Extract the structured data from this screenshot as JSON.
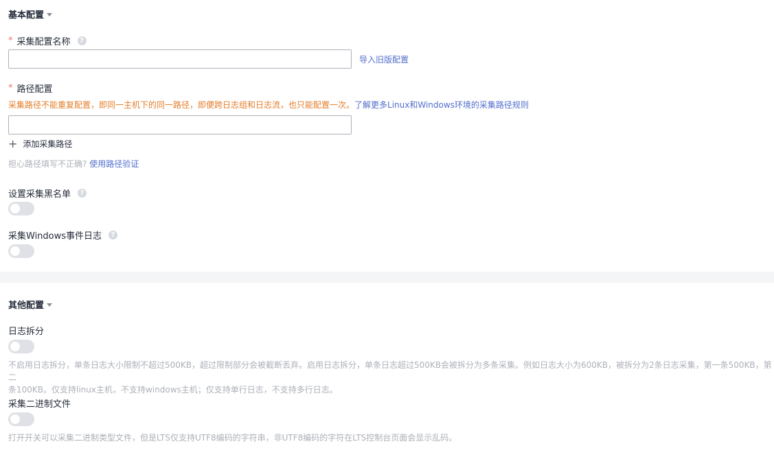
{
  "basic": {
    "title": "基本配置",
    "config_name": {
      "label": "采集配置名称",
      "value": ""
    },
    "import_link": "导入旧版配置",
    "path": {
      "label": "路径配置",
      "warning": "采集路径不能重复配置，即同一主机下的同一路径，即便跨日志组和日志流，也只能配置一次。",
      "rules_link": "了解更多Linux和Windows环境的采集路径规则",
      "value": "",
      "add_label": "添加采集路径",
      "hint": "担心路径填写不正确?",
      "verify_link": "使用路径验证"
    },
    "blacklist": {
      "label": "设置采集黑名单",
      "enabled": false
    },
    "windows_events": {
      "label": "采集Windows事件日志",
      "enabled": false
    }
  },
  "other": {
    "title": "其他配置",
    "log_split": {
      "label": "日志拆分",
      "enabled": false,
      "desc_line1": "不启用日志拆分，单条日志大小限制不超过500KB，超过限制部分会被截断丢弃。启用日志拆分，单条日志超过500KB会被拆分为多条采集。例如日志大小为600KB，被拆分为2条日志采集，第一条500KB，第二",
      "desc_line2": "条100KB。仅支持linux主机，不支持windows主机；仅支持单行日志，不支持多行日志。"
    },
    "binary": {
      "label": "采集二进制文件",
      "enabled": false,
      "desc": "打开开关可以采集二进制类型文件，但是LTS仅支持UTF8编码的字符串，非UTF8编码的字符在LTS控制台页面会显示乱码。"
    }
  }
}
